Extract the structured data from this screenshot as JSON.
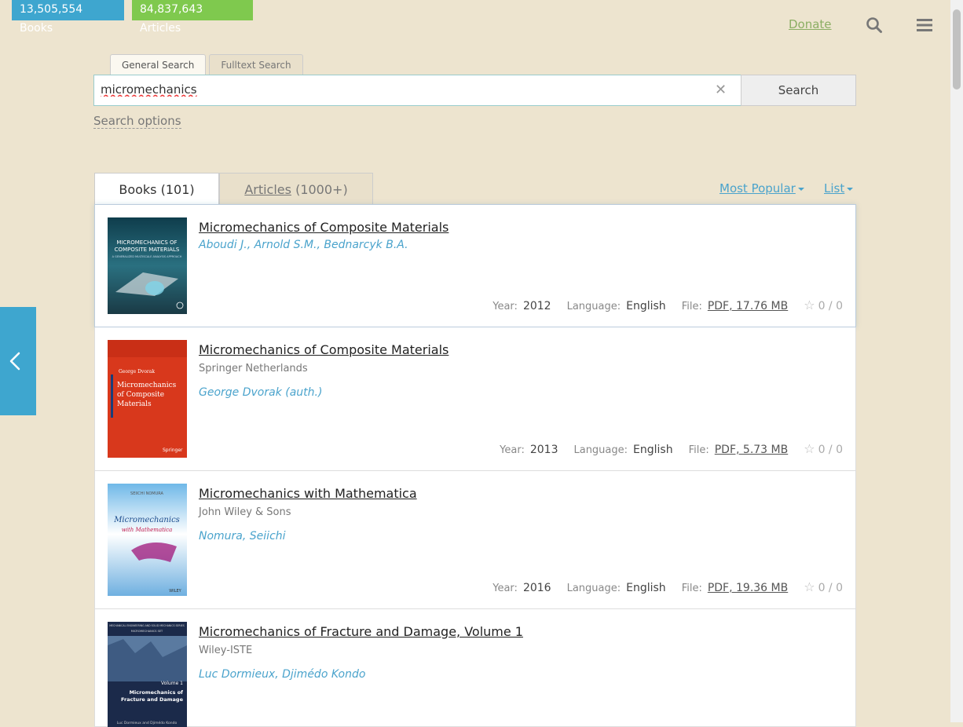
{
  "stats": {
    "books": "13,505,554 Books",
    "articles": "84,837,643 Articles"
  },
  "header": {
    "donate": "Donate",
    "search_icon": "search-icon",
    "menu_icon": "hamburger-menu-icon"
  },
  "search": {
    "tabs": [
      "General Search",
      "Fulltext Search"
    ],
    "query": "micromechanics",
    "button": "Search",
    "options_link": "Search options"
  },
  "results_tabs": {
    "books_label": "Books (101)",
    "articles_label": "Articles",
    "articles_count": "(1000+)"
  },
  "sort": {
    "order": "Most Popular",
    "view": "List"
  },
  "labels": {
    "year": "Year:",
    "language": "Language:",
    "file": "File:"
  },
  "books": [
    {
      "title": "Micromechanics of Composite Materials",
      "publisher": "",
      "authors": "Aboudi J., Arnold S.M., Bednarcyk B.A.",
      "year": "2012",
      "language": "English",
      "file": "PDF, 17.76 MB",
      "rating": "0 / 0",
      "cover_text": [
        "MICROMECHANICS OF",
        "COMPOSITE MATERIALS",
        "A GENERALIZED MULTISCALE ANALYSIS APPROACH"
      ],
      "cover_color": "#1f5a6a"
    },
    {
      "title": "Micromechanics of Composite Materials",
      "publisher": "Springer Netherlands",
      "authors": "George Dvorak (auth.)",
      "year": "2013",
      "language": "English",
      "file": "PDF, 5.73 MB",
      "rating": "0 / 0",
      "cover_text": [
        "George Dvorak",
        "Micromechanics",
        "of Composite",
        "Materials",
        "Springer"
      ],
      "cover_color": "#d8381c"
    },
    {
      "title": "Micromechanics with Mathematica",
      "publisher": "John Wiley & Sons",
      "authors": "Nomura, Seiichi",
      "year": "2016",
      "language": "English",
      "file": "PDF, 19.36 MB",
      "rating": "0 / 0",
      "cover_text": [
        "SEIICHI NOMURA",
        "Micromechanics",
        "with Mathematica",
        "WILEY"
      ],
      "cover_color": "#2f8fd0"
    },
    {
      "title": "Micromechanics of Fracture and Damage, Volume 1",
      "publisher": "Wiley-ISTE",
      "authors": "Luc Dormieux, Djimédo Kondo",
      "year": "",
      "language": "",
      "file": "",
      "rating": "",
      "cover_text": [
        "MECHANICAL ENGINEERING AND SOLID MECHANICS SERIES",
        "MICROMECHANICS SET",
        "Volume 1",
        "Micromechanics of",
        "Fracture and Damage",
        "Luc Dormieux and Djimédo Kondo"
      ],
      "cover_color": "#1b2a4a"
    }
  ],
  "colors": {
    "background": "#ede4cf",
    "books_badge": "#3ea6cf",
    "articles_badge": "#7fc94e",
    "link": "#4aa3cc",
    "donate": "#8bae63"
  },
  "side_panel": {
    "icon": "chevron-left-icon"
  }
}
